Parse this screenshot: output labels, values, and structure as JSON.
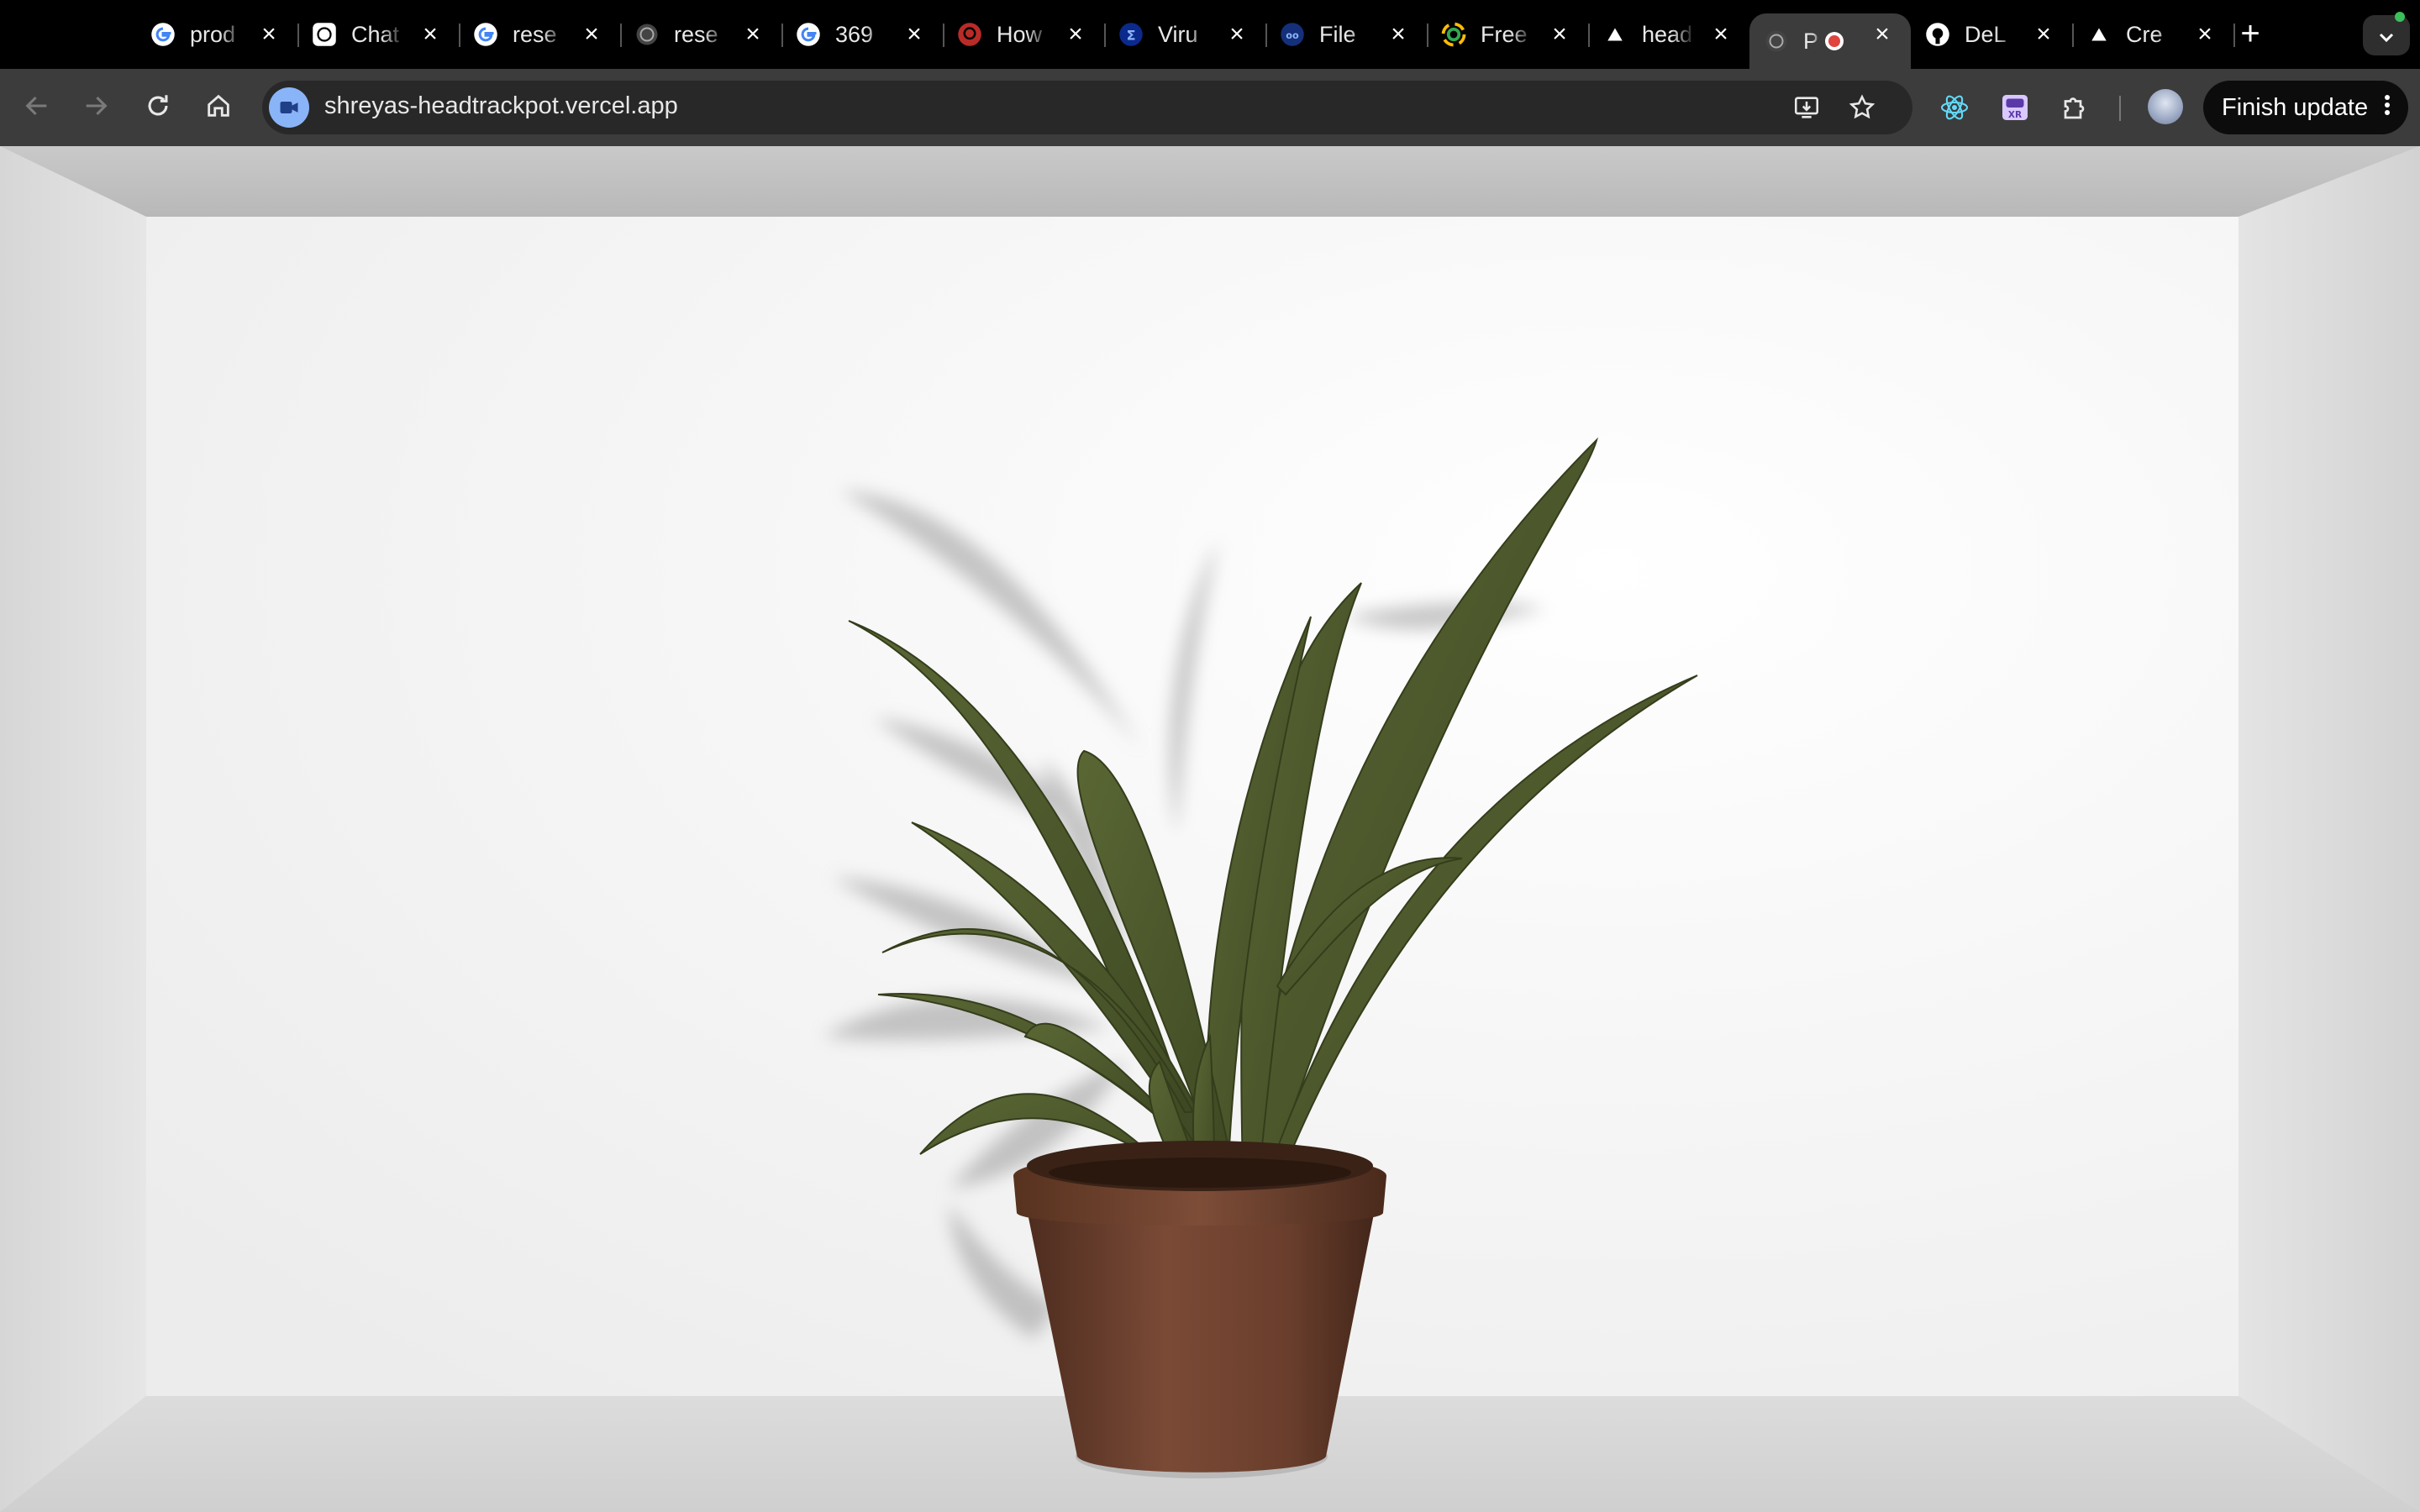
{
  "tabs": [
    {
      "title": "prod",
      "favicon": "google-icon"
    },
    {
      "title": "Chat",
      "favicon": "chatgpt-icon"
    },
    {
      "title": "rese",
      "favicon": "google-icon"
    },
    {
      "title": "rese",
      "favicon": "globe-icon"
    },
    {
      "title": "369",
      "favicon": "google-icon"
    },
    {
      "title": "How",
      "favicon": "quora-icon"
    },
    {
      "title": "Viru",
      "favicon": "virustotal-icon"
    },
    {
      "title": "File",
      "favicon": "file-converter-icon"
    },
    {
      "title": "Free",
      "favicon": "spinner-logo-icon"
    },
    {
      "title": "head",
      "favicon": "vercel-icon"
    },
    {
      "title": "P",
      "favicon": "globe-icon",
      "active": true,
      "recording": true
    },
    {
      "title": "DeL",
      "favicon": "github-icon"
    },
    {
      "title": "Cre",
      "favicon": "vercel-icon"
    }
  ],
  "new_tab_label": "+",
  "address_bar": {
    "url": "shreyas-headtrackpot.vercel.app"
  },
  "toolbar": {
    "update_label": "Finish update"
  },
  "extensions": [
    "react-devtools-icon",
    "webxr-icon",
    "puzzle-icon"
  ],
  "colors": {
    "tab_strip": "#000000",
    "toolbar": "#3c3c3c",
    "omnibox": "#282828",
    "recording": "#e0443e",
    "wall": "#f4f4f4",
    "leaf": "#4d5a2c",
    "pot": "#6a3e2c"
  }
}
